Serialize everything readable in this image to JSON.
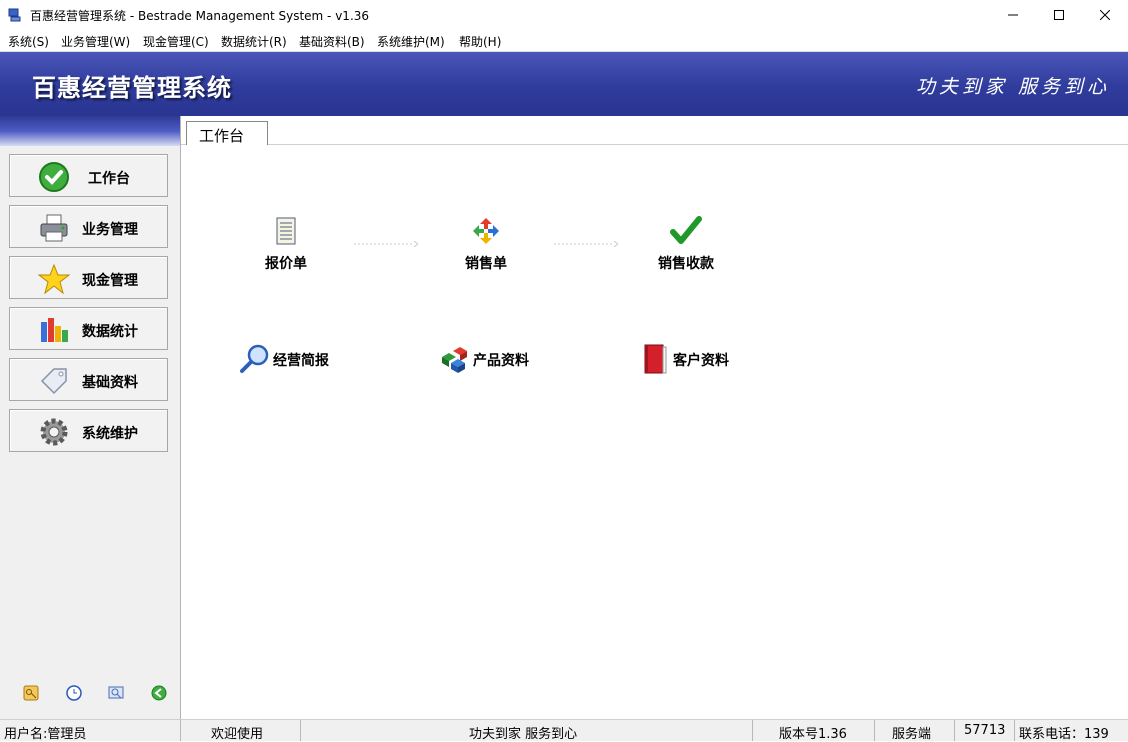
{
  "window": {
    "title": "百惠经营管理系统 - Bestrade Management System - v1.36"
  },
  "menu": [
    "系统(S)",
    "业务管理(W)",
    "现金管理(C)",
    "数据统计(R)",
    "基础资料(B)",
    "系统维护(M)",
    "帮助(H)"
  ],
  "banner": {
    "title": "百惠经营管理系统",
    "slogan": "功夫到家 服务到心"
  },
  "sidebar": {
    "items": [
      {
        "label": "工作台",
        "icon": "check-icon"
      },
      {
        "label": "业务管理",
        "icon": "printer-icon"
      },
      {
        "label": "现金管理",
        "icon": "star-icon"
      },
      {
        "label": "数据统计",
        "icon": "bar-chart-icon"
      },
      {
        "label": "基础资料",
        "icon": "tag-icon"
      },
      {
        "label": "系统维护",
        "icon": "gear-icon"
      }
    ],
    "tools": [
      "key-icon",
      "clock-icon",
      "magnifier-window-icon",
      "back-icon"
    ]
  },
  "tab": {
    "label": "工作台"
  },
  "workflow": [
    {
      "label": "报价单",
      "icon": "document-icon"
    },
    {
      "label": "销售单",
      "icon": "recycle-arrows-icon"
    },
    {
      "label": "销售收款",
      "icon": "checkmark-icon"
    }
  ],
  "quick": [
    {
      "label": "经营简报",
      "icon": "magnifier-icon"
    },
    {
      "label": "产品资料",
      "icon": "cubes-icon"
    },
    {
      "label": "客户资料",
      "icon": "red-book-icon"
    }
  ],
  "status": {
    "user": "用户名:管理员",
    "welcome": "欢迎使用",
    "slogan": "功夫到家 服务到心",
    "version": "版本号1.36",
    "server": "服务端",
    "port": "57713",
    "phone": "联系电话：139"
  },
  "colors": {
    "banner": "#303c9c",
    "sidebar_head": "#2f3a96",
    "sidebar_bg": "#f0f0f0"
  }
}
